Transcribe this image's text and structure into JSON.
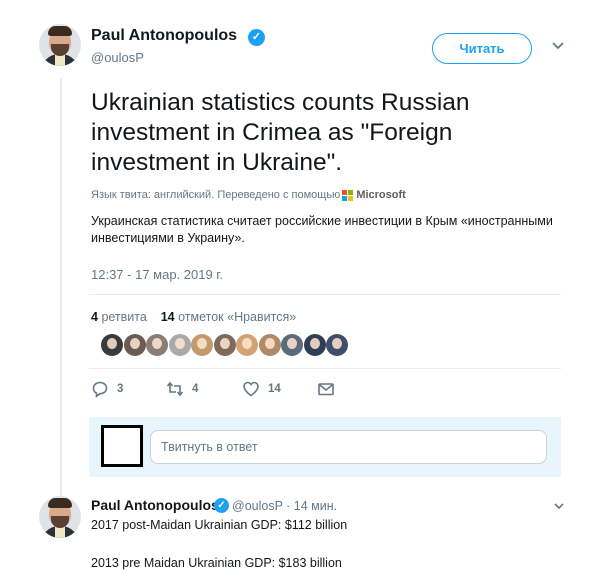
{
  "author": {
    "name": "Paul Antonopoulos",
    "handle": "@oulosP",
    "verified_glyph": "✓"
  },
  "follow_button": {
    "label": "Читать"
  },
  "tweet": {
    "text": "Ukrainian statistics counts Russian investment in Crimea as \"Foreign investment in Ukraine\".",
    "translation_note": "Язык твита: английский. Переведено с помощью",
    "translation_provider": "Microsoft",
    "translated_text": "Украинская статистика считает российские инвестиции в Крым «иностранными инвестициями в Украину».",
    "timestamp": "12:37 - 17 мар. 2019 г."
  },
  "stats": {
    "retweets_count": "4",
    "retweets_label": "ретвита",
    "likes_count": "14",
    "likes_label": "отметок «Нравится»"
  },
  "likers": [
    {
      "color": "#3a3a3a"
    },
    {
      "color": "#6b5b52"
    },
    {
      "color": "#8a7d75"
    },
    {
      "color": "#a9a9a9"
    },
    {
      "color": "#c49a6c"
    },
    {
      "color": "#7f6a5a"
    },
    {
      "color": "#d4a373"
    },
    {
      "color": "#b08968"
    },
    {
      "color": "#5c6b7a"
    },
    {
      "color": "#2f3e55"
    },
    {
      "color": "#3d4f6b"
    }
  ],
  "actions": {
    "reply_count": "3",
    "retweet_count": "4",
    "like_count": "14",
    "reply_icon": "reply-icon",
    "retweet_icon": "retweet-icon",
    "like_icon": "heart-icon",
    "message_icon": "envelope-icon"
  },
  "reply_compose": {
    "placeholder": "Твитнуть в ответ"
  },
  "reply_tweet": {
    "name": "Paul Antonopoulos",
    "handle": "@oulosP",
    "time": "· 14 мин.",
    "line1": "2017 post-Maidan Ukrainian GDP: $112 billion",
    "line2": "2013 pre Maidan Ukrainian GDP: $183 billion"
  },
  "colors": {
    "accent": "#1da1f2",
    "secondary_text": "#657786",
    "reply_box_bg": "#e8f5fd"
  }
}
